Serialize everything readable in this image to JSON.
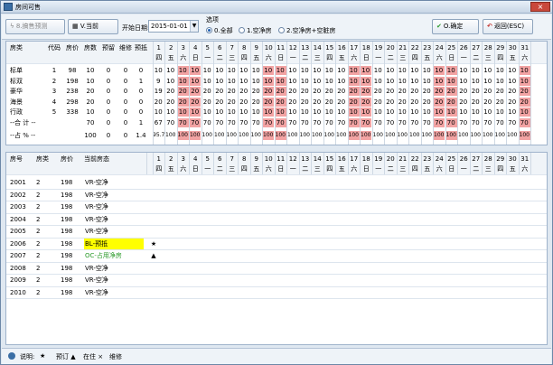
{
  "window": {
    "title": "房间可售",
    "close": "×"
  },
  "toolbar": {
    "forecast_label": "8.搞售预测",
    "current_label": "V.当前",
    "start_date_label": "开始日期:",
    "start_date_value": "2015-01-01",
    "options_label": "选项",
    "radio": [
      "0.全部",
      "1.空净房",
      "2.空净房+空脏房"
    ],
    "radio_selected": 0,
    "ok_label": "O.确定",
    "back_label": "返回(ESC)"
  },
  "days": [
    "1",
    "2",
    "3",
    "4",
    "5",
    "6",
    "7",
    "8",
    "9",
    "10",
    "11",
    "12",
    "13",
    "14",
    "15",
    "16",
    "17",
    "18",
    "19",
    "20",
    "21",
    "22",
    "23",
    "24",
    "25",
    "26",
    "27",
    "28",
    "29",
    "30",
    "31"
  ],
  "weekdays": [
    "四",
    "五",
    "六",
    "日",
    "一",
    "二",
    "三",
    "四",
    "五",
    "六",
    "日",
    "一",
    "二",
    "三",
    "四",
    "五",
    "六",
    "日",
    "一",
    "二",
    "三",
    "四",
    "五",
    "六",
    "日",
    "一",
    "二",
    "三",
    "四",
    "五",
    "六"
  ],
  "summary": {
    "headers": [
      "房类",
      "代码",
      "房价",
      "房数",
      "预留",
      "维修",
      "预抵"
    ],
    "highlight_days": [
      3,
      4,
      10,
      11,
      17,
      18,
      24,
      25,
      31
    ],
    "rows": [
      {
        "type": "标单",
        "code": "1",
        "price": "98",
        "count": "10",
        "reserve": "0",
        "repair": "0",
        "arrive": "0",
        "values": [
          "10",
          "10",
          "10",
          "10",
          "10",
          "10",
          "10",
          "10",
          "10",
          "10",
          "10",
          "10",
          "10",
          "10",
          "10",
          "10",
          "10",
          "10",
          "10",
          "10",
          "10",
          "10",
          "10",
          "10",
          "10",
          "10",
          "10",
          "10",
          "10",
          "10",
          "10"
        ]
      },
      {
        "type": "标双",
        "code": "2",
        "price": "198",
        "count": "10",
        "reserve": "0",
        "repair": "0",
        "arrive": "1",
        "values": [
          "9",
          "10",
          "10",
          "10",
          "10",
          "10",
          "10",
          "10",
          "10",
          "10",
          "10",
          "10",
          "10",
          "10",
          "10",
          "10",
          "10",
          "10",
          "10",
          "10",
          "10",
          "10",
          "10",
          "10",
          "10",
          "10",
          "10",
          "10",
          "10",
          "10",
          "10"
        ]
      },
      {
        "type": "豪华",
        "code": "3",
        "price": "238",
        "count": "20",
        "reserve": "0",
        "repair": "0",
        "arrive": "0",
        "values": [
          "19",
          "20",
          "20",
          "20",
          "20",
          "20",
          "20",
          "20",
          "20",
          "20",
          "20",
          "20",
          "20",
          "20",
          "20",
          "20",
          "20",
          "20",
          "20",
          "20",
          "20",
          "20",
          "20",
          "20",
          "20",
          "20",
          "20",
          "20",
          "20",
          "20",
          "20"
        ]
      },
      {
        "type": "海景",
        "code": "4",
        "price": "298",
        "count": "20",
        "reserve": "0",
        "repair": "0",
        "arrive": "0",
        "values": [
          "20",
          "20",
          "20",
          "20",
          "20",
          "20",
          "20",
          "20",
          "20",
          "20",
          "20",
          "20",
          "20",
          "20",
          "20",
          "20",
          "20",
          "20",
          "20",
          "20",
          "20",
          "20",
          "20",
          "20",
          "20",
          "20",
          "20",
          "20",
          "20",
          "20",
          "20"
        ]
      },
      {
        "type": "行政",
        "code": "5",
        "price": "338",
        "count": "10",
        "reserve": "0",
        "repair": "0",
        "arrive": "0",
        "values": [
          "10",
          "10",
          "10",
          "10",
          "10",
          "10",
          "10",
          "10",
          "10",
          "10",
          "10",
          "10",
          "10",
          "10",
          "10",
          "10",
          "10",
          "10",
          "10",
          "10",
          "10",
          "10",
          "10",
          "10",
          "10",
          "10",
          "10",
          "10",
          "10",
          "10",
          "10"
        ]
      }
    ],
    "total_row": {
      "label": "--合 计 --",
      "count": "70",
      "reserve": "0",
      "repair": "0",
      "arrive": "1",
      "values": [
        "67",
        "70",
        "70",
        "70",
        "70",
        "70",
        "70",
        "70",
        "70",
        "70",
        "70",
        "70",
        "70",
        "70",
        "70",
        "70",
        "70",
        "70",
        "70",
        "70",
        "70",
        "70",
        "70",
        "70",
        "70",
        "70",
        "70",
        "70",
        "70",
        "70",
        "70"
      ]
    },
    "percent_row": {
      "label": "--占 % --",
      "count": "100",
      "reserve": "0",
      "repair": "0",
      "arrive": "1.4",
      "values": [
        "95.7",
        "100",
        "100",
        "100",
        "100",
        "100",
        "100",
        "100",
        "100",
        "100",
        "100",
        "100",
        "100",
        "100",
        "100",
        "100",
        "100",
        "100",
        "100",
        "100",
        "100",
        "100",
        "100",
        "100",
        "100",
        "100",
        "100",
        "100",
        "100",
        "100",
        "100"
      ]
    }
  },
  "rooms": {
    "headers": [
      "房号",
      "房类",
      "房价",
      "当前房态"
    ],
    "rows": [
      {
        "no": "2001",
        "type": "2",
        "price": "198",
        "status": "VR-空净",
        "mark": ""
      },
      {
        "no": "2002",
        "type": "2",
        "price": "198",
        "status": "VR-空净",
        "mark": ""
      },
      {
        "no": "2003",
        "type": "2",
        "price": "198",
        "status": "VR-空净",
        "mark": ""
      },
      {
        "no": "2004",
        "type": "2",
        "price": "198",
        "status": "VR-空净",
        "mark": ""
      },
      {
        "no": "2005",
        "type": "2",
        "price": "198",
        "status": "VR-空净",
        "mark": ""
      },
      {
        "no": "2006",
        "type": "2",
        "price": "198",
        "status": "BL-预抵",
        "mark": "★"
      },
      {
        "no": "2007",
        "type": "2",
        "price": "198",
        "status": "OC-占用净房",
        "mark": "▲"
      },
      {
        "no": "2008",
        "type": "2",
        "price": "198",
        "status": "VR-空净",
        "mark": ""
      },
      {
        "no": "2009",
        "type": "2",
        "price": "198",
        "status": "VR-空净",
        "mark": ""
      },
      {
        "no": "2010",
        "type": "2",
        "price": "198",
        "status": "VR-空净",
        "mark": ""
      }
    ]
  },
  "statusbar": {
    "legend": "说明:",
    "items": [
      "★",
      "预订 ▲",
      "在住 ×",
      "维修"
    ]
  },
  "colors": {
    "highlight": "#f2a3a3",
    "bl_status": "#ffff00",
    "oc_status": "#2a9a2a"
  }
}
